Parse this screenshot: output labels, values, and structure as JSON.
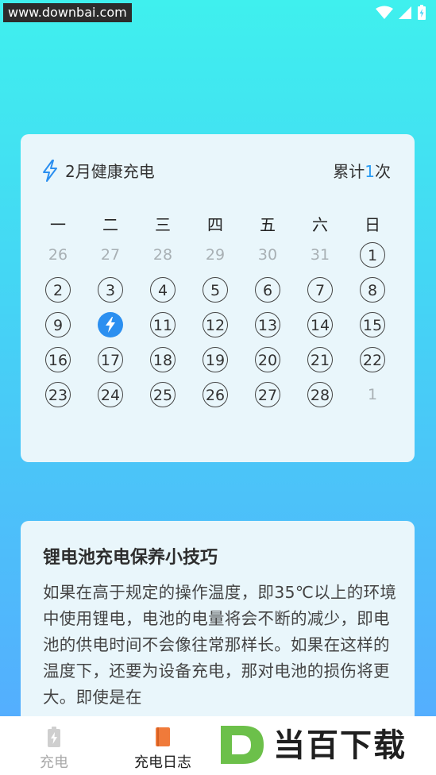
{
  "status_bar": {
    "watermark": "www.downbai.com"
  },
  "calendar": {
    "title": "2月健康充电",
    "count_prefix": "累计",
    "count_value": "1",
    "count_suffix": "次",
    "weekdays": [
      "一",
      "二",
      "三",
      "四",
      "五",
      "六",
      "日"
    ],
    "rows": [
      [
        {
          "d": "26",
          "s": "other"
        },
        {
          "d": "27",
          "s": "other"
        },
        {
          "d": "28",
          "s": "other"
        },
        {
          "d": "29",
          "s": "other"
        },
        {
          "d": "30",
          "s": "other"
        },
        {
          "d": "31",
          "s": "other"
        },
        {
          "d": "1",
          "s": "cur"
        }
      ],
      [
        {
          "d": "2",
          "s": "cur"
        },
        {
          "d": "3",
          "s": "cur"
        },
        {
          "d": "4",
          "s": "cur"
        },
        {
          "d": "5",
          "s": "cur"
        },
        {
          "d": "6",
          "s": "cur"
        },
        {
          "d": "7",
          "s": "cur"
        },
        {
          "d": "8",
          "s": "cur"
        }
      ],
      [
        {
          "d": "9",
          "s": "cur"
        },
        {
          "d": "",
          "s": "charged"
        },
        {
          "d": "11",
          "s": "cur"
        },
        {
          "d": "12",
          "s": "cur"
        },
        {
          "d": "13",
          "s": "cur"
        },
        {
          "d": "14",
          "s": "cur"
        },
        {
          "d": "15",
          "s": "cur"
        }
      ],
      [
        {
          "d": "16",
          "s": "cur"
        },
        {
          "d": "17",
          "s": "cur"
        },
        {
          "d": "18",
          "s": "cur"
        },
        {
          "d": "19",
          "s": "cur"
        },
        {
          "d": "20",
          "s": "cur"
        },
        {
          "d": "21",
          "s": "cur"
        },
        {
          "d": "22",
          "s": "cur"
        }
      ],
      [
        {
          "d": "23",
          "s": "cur"
        },
        {
          "d": "24",
          "s": "cur"
        },
        {
          "d": "25",
          "s": "cur"
        },
        {
          "d": "26",
          "s": "cur"
        },
        {
          "d": "27",
          "s": "cur"
        },
        {
          "d": "28",
          "s": "cur"
        },
        {
          "d": "1",
          "s": "other"
        }
      ]
    ]
  },
  "tips": {
    "title": "锂电池充电保养小技巧",
    "body": "如果在高于规定的操作温度，即35℃以上的环境中使用锂电，电池的电量将会不断的减少，即电池的供电时间不会像往常那样长。如果在这样的温度下，还要为设备充电，那对电池的损伤将更大。即使是在"
  },
  "tabbar": {
    "tabs": [
      {
        "label": "充电",
        "active": false
      },
      {
        "label": "充电日志",
        "active": true
      }
    ]
  },
  "logo": {
    "text": "当百下载"
  },
  "colors": {
    "accent": "#2b8ff0",
    "card": "#e9f6fb",
    "log_icon": "#f07a3a"
  }
}
